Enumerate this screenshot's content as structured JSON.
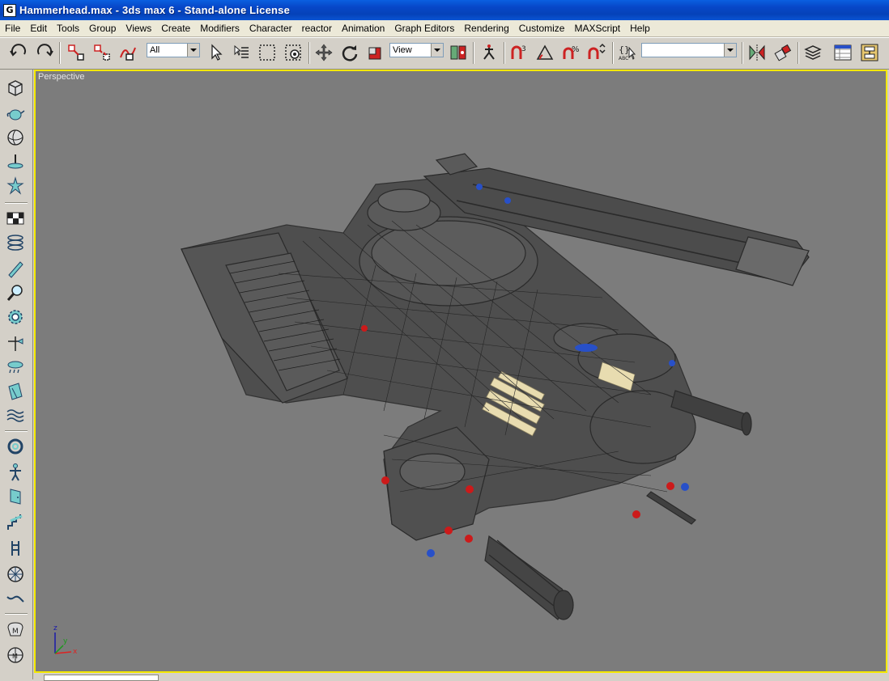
{
  "window": {
    "title": "Hammerhead.max - 3ds max 6 - Stand-alone License",
    "icon_glyph": "G"
  },
  "menu": [
    "File",
    "Edit",
    "Tools",
    "Group",
    "Views",
    "Create",
    "Modifiers",
    "Character",
    "reactor",
    "Animation",
    "Graph Editors",
    "Rendering",
    "Customize",
    "MAXScript",
    "Help"
  ],
  "toolbar": {
    "selection_filter": "All",
    "reference_coord_system": "View",
    "named_selection_set": "",
    "icons": [
      "undo-icon",
      "redo-icon",
      "select-and-link-icon",
      "unlink-selection-icon",
      "bind-to-space-warp-icon",
      "select-object-icon",
      "select-by-name-icon",
      "rectangular-selection-region-icon",
      "window-crossing-icon",
      "select-and-move-icon",
      "select-and-rotate-icon",
      "select-and-scale-icon",
      "use-pivot-center-icon",
      "select-and-manipulate-icon",
      "snaps-toggle-icon",
      "angle-snap-icon",
      "percent-snap-icon",
      "spinner-snap-icon",
      "edit-named-selections-icon",
      "mirror-icon",
      "align-icon",
      "layer-manager-icon",
      "curve-editor-icon",
      "schematic-view-icon"
    ]
  },
  "left_tabs": [
    "box-icon",
    "teapot-icon",
    "sphere-icon",
    "plane-icon",
    "star-icon",
    "checker-icon",
    "helix-icon",
    "cylinder-icon",
    "magnifier-icon",
    "gear-icon",
    "weather-vane-icon",
    "rain-icon",
    "light-icon",
    "waves-icon",
    "torus-knot-icon",
    "biped-icon",
    "door-icon",
    "stairs-icon",
    "tree-icon",
    "wheel-icon",
    "rope-icon",
    "mental-ray-icon",
    "sphere-grid-icon"
  ],
  "viewport": {
    "label": "Perspective",
    "active_border_color": "#f4e800",
    "background_color": "#7c7c7c"
  },
  "axis": {
    "x": "x",
    "y": "y",
    "z": "z"
  },
  "colors": {
    "titlebar": "#0747c8",
    "wire": "#2a2a2a",
    "highlight_red": "#cc1a1a",
    "highlight_blue": "#2850c8",
    "highlight_cream": "#e8dcb0"
  }
}
